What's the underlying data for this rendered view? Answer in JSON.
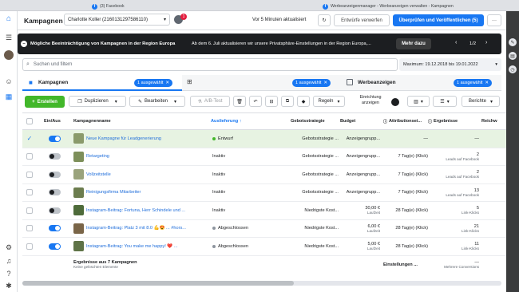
{
  "browser": {
    "tab1": "(3) Facebook",
    "tab2": "Werbeanzeigenmanager - Werbeanzeigen verwalten - Kampagnen"
  },
  "header": {
    "title": "Kampagnen",
    "account": "Charlotte Koller (2160131297586110)",
    "update": "Vor 5 Minuten aktualisiert",
    "discard": "Entwürfe verwerfen",
    "publish": "Überprüfen und Veröffentlichen (5)",
    "badge": "1"
  },
  "notice": {
    "title": "Mögliche Beeinträchtigung von Kampagnen in der Region Europa",
    "text": "Ab dem 6. Juli aktualisieren wir unsere Privatsphäre-Einstellungen in der Region Europa,...",
    "more": "Mehr dazu",
    "pager": "1/2"
  },
  "search": {
    "placeholder": "Suchen und filtern",
    "daterange": "Maximum: 19.12.2018 bis 19.01.2022"
  },
  "tabs": {
    "campaigns": "Kampagnen",
    "campaigns_sel": "1 ausgewählt",
    "adsets_sel": "1 ausgewählt",
    "ads": "Werbeanzeigen",
    "ads_sel": "1 ausgewählt"
  },
  "toolbar": {
    "create": "Erstellen",
    "duplicate": "Duplizieren",
    "edit": "Bearbeiten",
    "abtest": "A/B-Test",
    "rules": "Regeln",
    "display_settings": "Einrichtung anzeigen",
    "reports": "Berichte"
  },
  "columns": {
    "onoff": "Ein/Aus",
    "name": "Kampagnenname",
    "delivery": "Auslieferung ↑",
    "bidstrategy": "Gebotsstrategie",
    "budget": "Budget",
    "attribution": "Attributionsei...",
    "results": "Ergebnisse",
    "reach": "Reichw"
  },
  "rows": [
    {
      "name": "Neue Kampagne für Leadgenerierung",
      "delivery": "Entwurf",
      "bid": "Gebotsstrategie ...",
      "budget": "Anzeigengrupp...",
      "budget_sub": "",
      "attr": "—",
      "results": "—",
      "results_sub": "",
      "on": true,
      "checked": true,
      "status": "draft",
      "thumb": "#8a9a6b"
    },
    {
      "name": "Retargeting",
      "delivery": "Inaktiv",
      "bid": "Gebotsstrategie ...",
      "budget": "Anzeigengrupp...",
      "budget_sub": "",
      "attr": "7 Tag(e) (Klick)",
      "results": "2",
      "results_sub": "Leads auf Facebook",
      "on": false,
      "checked": false,
      "status": "none",
      "thumb": "#7d8f5a"
    },
    {
      "name": "Vollzeitstelle",
      "delivery": "Inaktiv",
      "bid": "Gebotsstrategie ...",
      "budget": "Anzeigengrupp...",
      "budget_sub": "",
      "attr": "7 Tag(e) (Klick)",
      "results": "2",
      "results_sub": "Leads auf Facebook",
      "on": false,
      "checked": false,
      "status": "none",
      "thumb": "#9aa37c"
    },
    {
      "name": "Reinigungsfirma Mitarbeiter",
      "delivery": "Inaktiv",
      "bid": "Gebotsstrategie ...",
      "budget": "Anzeigengrupp...",
      "budget_sub": "",
      "attr": "7 Tag(e) (Klick)",
      "results": "13",
      "results_sub": "Leads auf Facebook",
      "on": false,
      "checked": false,
      "status": "none",
      "thumb": "#6c7d4f"
    },
    {
      "name": "Instagram-Beitrag: Fortuna, Herr Schindele und ...",
      "delivery": "Inaktiv",
      "bid": "Niedrigste Kost...",
      "budget": "30,00 €",
      "budget_sub": "Laufzeit",
      "attr": "28 Tag(e) (Klick)",
      "results": "5",
      "results_sub": "Link-Klicks",
      "on": false,
      "checked": false,
      "status": "none",
      "thumb": "#4e6b3a"
    },
    {
      "name": "Instagram-Beitrag: Platz 3 mit 8.0 💪😍 ... #hors...",
      "delivery": "Abgeschlossen",
      "bid": "Niedrigste Kost...",
      "budget": "6,00 €",
      "budget_sub": "Laufzeit",
      "attr": "28 Tag(e) (Klick)",
      "results": "21",
      "results_sub": "Link-Klicks",
      "on": true,
      "checked": false,
      "status": "done",
      "thumb": "#7a6548"
    },
    {
      "name": "Instagram-Beitrag: You make me happy! ❤️ ...",
      "delivery": "Abgeschlossen",
      "bid": "Niedrigste Kost...",
      "budget": "5,00 €",
      "budget_sub": "Laufzeit",
      "attr": "28 Tag(e) (Klick)",
      "results": "11",
      "results_sub": "Link-Klicks",
      "on": true,
      "checked": false,
      "status": "done",
      "thumb": "#5f7347"
    }
  ],
  "footer": {
    "title": "Ergebnisse aus 7 Kampagnen",
    "sub": "Keine gelöschten Elemente",
    "attr": "Einstellungen ...",
    "results": "—",
    "results_sub": "Mehrere Conversions"
  },
  "colors": {
    "accent": "#1877f2",
    "create": "#42b72a",
    "draftrow": "#e7f3e2"
  }
}
